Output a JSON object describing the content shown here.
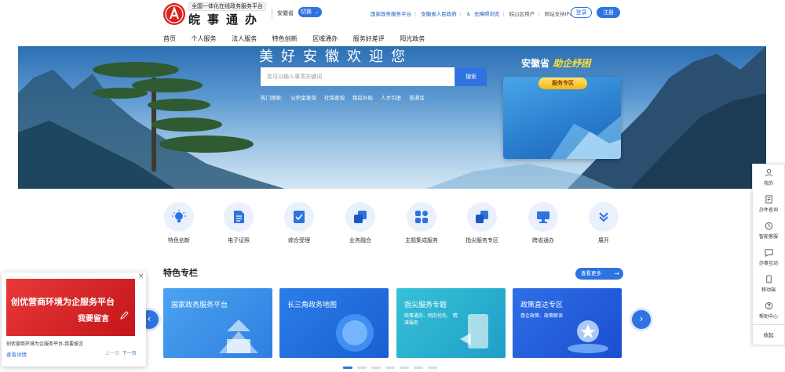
{
  "header": {
    "logo_tagline": "全国一体化在线政务服务平台",
    "logo_name": "皖事通办",
    "region": "安徽省",
    "switch_label": "切换",
    "links": [
      "国家政务服务平台",
      "安徽省人民政府",
      "无障碍浏览"
    ],
    "links_muted": [
      "皖山区用户",
      "网站支持IPv6"
    ],
    "login": "登录",
    "register": "注册"
  },
  "nav": [
    "首页",
    "个人服务",
    "法人服务",
    "特色创新",
    "区域通办",
    "服务好差评",
    "阳光政务"
  ],
  "banner": {
    "title": "美好安徽欢迎您",
    "search_placeholder": "您可以输入事项关键词",
    "search_button": "搜索",
    "hot_label": "热门搜索:",
    "hot_terms": [
      "公积金查询",
      "社保查询",
      "租房补贴",
      "人才引进",
      "普通话"
    ],
    "promo_title_prefix": "安徽省",
    "promo_title_highlight": "助企纾困",
    "promo_button": "服务专区"
  },
  "services": [
    {
      "label": "特色创新",
      "icon": "lightbulb-icon"
    },
    {
      "label": "电子证照",
      "icon": "document-icon"
    },
    {
      "label": "综合受理",
      "icon": "checklist-icon"
    },
    {
      "label": "业务融合",
      "icon": "merge-icon"
    },
    {
      "label": "主题集成服务",
      "icon": "grid-icon"
    },
    {
      "label": "指尖服务专区",
      "icon": "handheld-icon"
    },
    {
      "label": "跨省通办",
      "icon": "monitor-icon"
    },
    {
      "label": "展开",
      "icon": "double-chevron-down-icon"
    }
  ],
  "featured": {
    "title": "特色专栏",
    "more": "查看更多",
    "cards": [
      {
        "label": "国家政务服务平台",
        "sub": "",
        "color1": "#4aa3f0",
        "color2": "#2f7fe0"
      },
      {
        "label": "长三角政务地图",
        "sub": "",
        "color1": "#2a7ee8",
        "color2": "#1b5fd0"
      },
      {
        "label": "指尖服务专题",
        "sub": "皖事通办、网办优先、\n精准服务",
        "color1": "#38c0d8",
        "color2": "#1e9fc6"
      },
      {
        "label": "政策直达专区",
        "sub": "惠企政策、政策解读",
        "color1": "#2f6fe6",
        "color2": "#1a4ed0"
      }
    ]
  },
  "rightbar": {
    "items": [
      "我的",
      "办件查询",
      "智能客服",
      "办事互动",
      "移动端",
      "帮助中心"
    ],
    "collapse": "收起"
  },
  "popup": {
    "line1": "创优营商环境为企服务平台",
    "line2": "我要留言",
    "caption": "创优营商环境为企服务平台-我要留言",
    "link": "查看详情",
    "prev": "上一页",
    "next": "下一页"
  }
}
